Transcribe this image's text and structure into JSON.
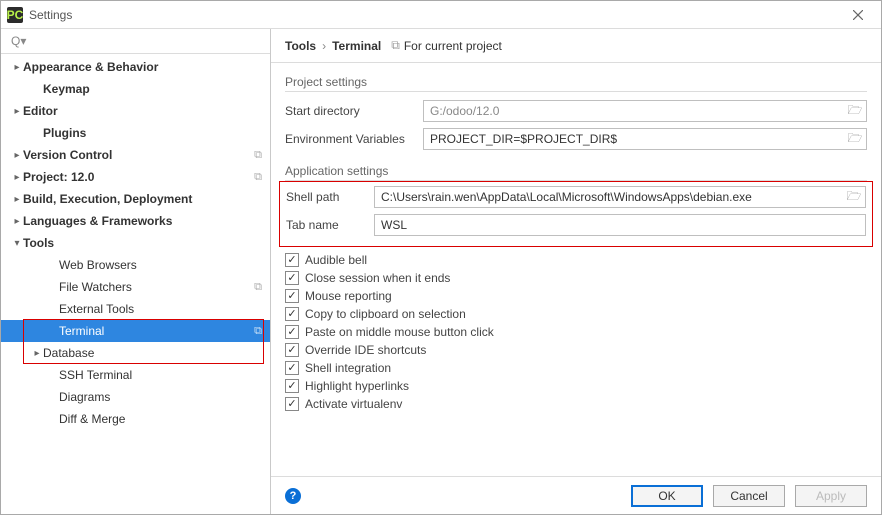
{
  "window_title": "Settings",
  "search_placeholder": "",
  "tree": {
    "appearance": "Appearance & Behavior",
    "keymap": "Keymap",
    "editor": "Editor",
    "plugins": "Plugins",
    "version_control": "Version Control",
    "project": "Project: 12.0",
    "build": "Build, Execution, Deployment",
    "langs": "Languages & Frameworks",
    "tools": "Tools",
    "web_browsers": "Web Browsers",
    "file_watchers": "File Watchers",
    "external_tools": "External Tools",
    "terminal": "Terminal",
    "database": "Database",
    "ssh_terminal": "SSH Terminal",
    "diagrams": "Diagrams",
    "diff_merge": "Diff & Merge"
  },
  "breadcrumb": {
    "root": "Tools",
    "leaf": "Terminal"
  },
  "for_current_project": "For current project",
  "project_settings": {
    "title": "Project settings",
    "start_dir_label": "Start directory",
    "start_dir_value": "G:/odoo/12.0",
    "env_label": "Environment Variables",
    "env_value": "PROJECT_DIR=$PROJECT_DIR$"
  },
  "app_settings": {
    "title": "Application settings",
    "shell_path_label": "Shell path",
    "shell_path_value": "C:\\Users\\rain.wen\\AppData\\Local\\Microsoft\\WindowsApps\\debian.exe",
    "tab_name_label": "Tab name",
    "tab_name_value": "WSL",
    "checks": {
      "audible": "Audible bell",
      "close_session": "Close session when it ends",
      "mouse_reporting": "Mouse reporting",
      "copy_clip": "Copy to clipboard on selection",
      "paste_middle": "Paste on middle mouse button click",
      "override_ide": "Override IDE shortcuts",
      "shell_int": "Shell integration",
      "highlight": "Highlight hyperlinks",
      "activate_venv": "Activate virtualenv"
    }
  },
  "buttons": {
    "ok": "OK",
    "cancel": "Cancel",
    "apply": "Apply"
  }
}
